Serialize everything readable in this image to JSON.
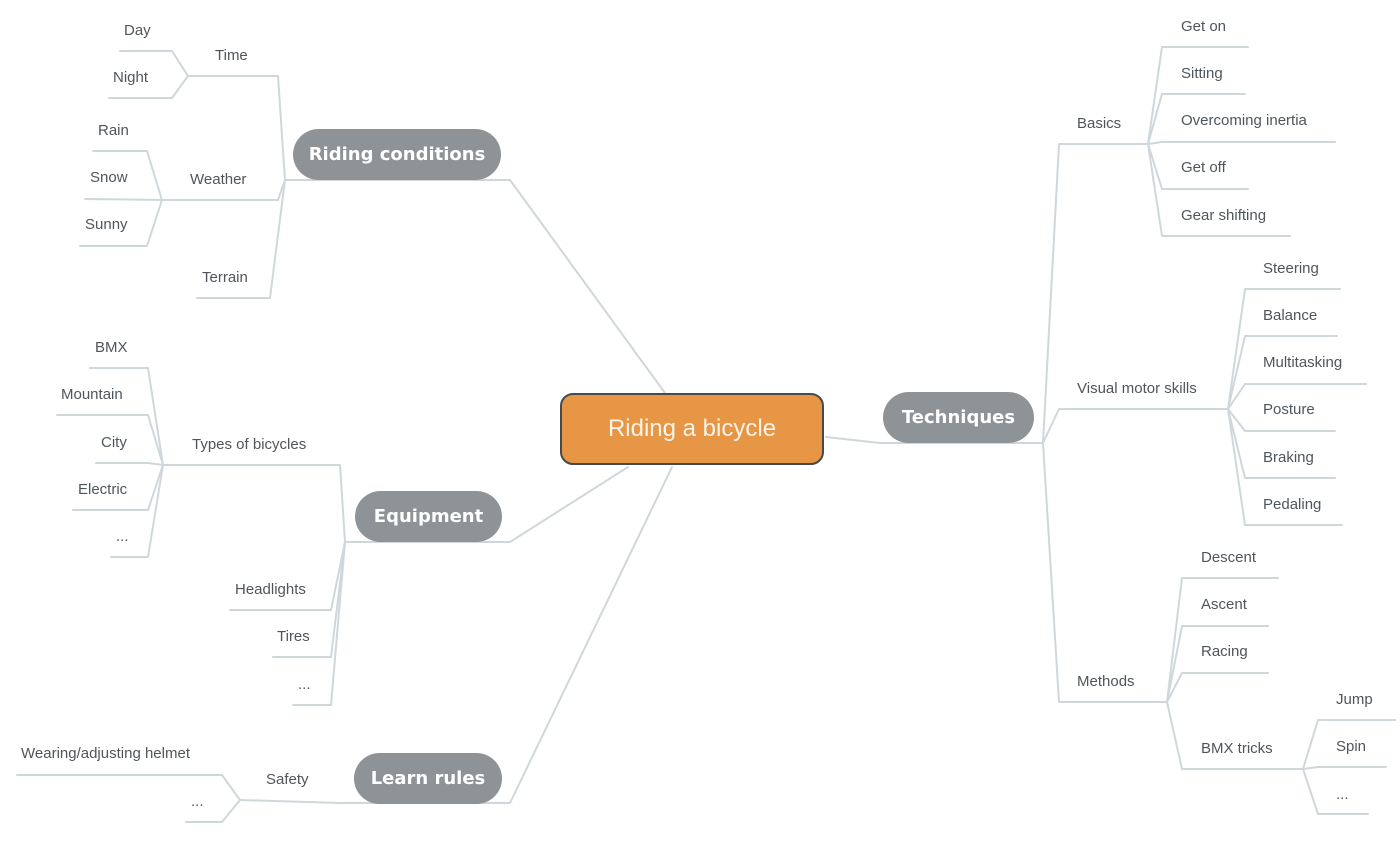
{
  "root": {
    "label": "Riding a bicycle",
    "color": "#e69644"
  },
  "colors": {
    "branch_pill": "#8d9397",
    "connector": "#d0d7db",
    "text": "#4f565b"
  },
  "branches": {
    "riding_conditions": {
      "label": "Riding conditions",
      "children": {
        "time": {
          "label": "Time",
          "children": [
            "Day",
            "Night"
          ]
        },
        "weather": {
          "label": "Weather",
          "children": [
            "Rain",
            "Snow",
            "Sunny"
          ]
        },
        "terrain": {
          "label": "Terrain"
        }
      }
    },
    "equipment": {
      "label": "Equipment",
      "children": {
        "types": {
          "label": "Types of bicycles",
          "children": [
            "BMX",
            "Mountain",
            "City",
            "Electric",
            "..."
          ]
        },
        "headlights": {
          "label": "Headlights"
        },
        "tires": {
          "label": "Tires"
        },
        "more": {
          "label": "..."
        }
      }
    },
    "learn_rules": {
      "label": "Learn rules",
      "children": {
        "safety": {
          "label": "Safety",
          "children": [
            "Wearing/adjusting helmet",
            "..."
          ]
        }
      }
    },
    "techniques": {
      "label": "Techniques",
      "children": {
        "basics": {
          "label": "Basics",
          "children": [
            "Get on",
            "Sitting",
            "Overcoming inertia",
            "Get off",
            "Gear shifting"
          ]
        },
        "visual_motor": {
          "label": "Visual motor skills",
          "children": [
            "Steering",
            "Balance",
            "Multitasking",
            "Posture",
            "Braking",
            "Pedaling"
          ]
        },
        "methods": {
          "label": "Methods",
          "children": [
            "Descent",
            "Ascent",
            "Racing"
          ],
          "bmx_tricks": {
            "label": "BMX tricks",
            "children": [
              "Jump",
              "Spin",
              "..."
            ]
          }
        }
      }
    }
  }
}
